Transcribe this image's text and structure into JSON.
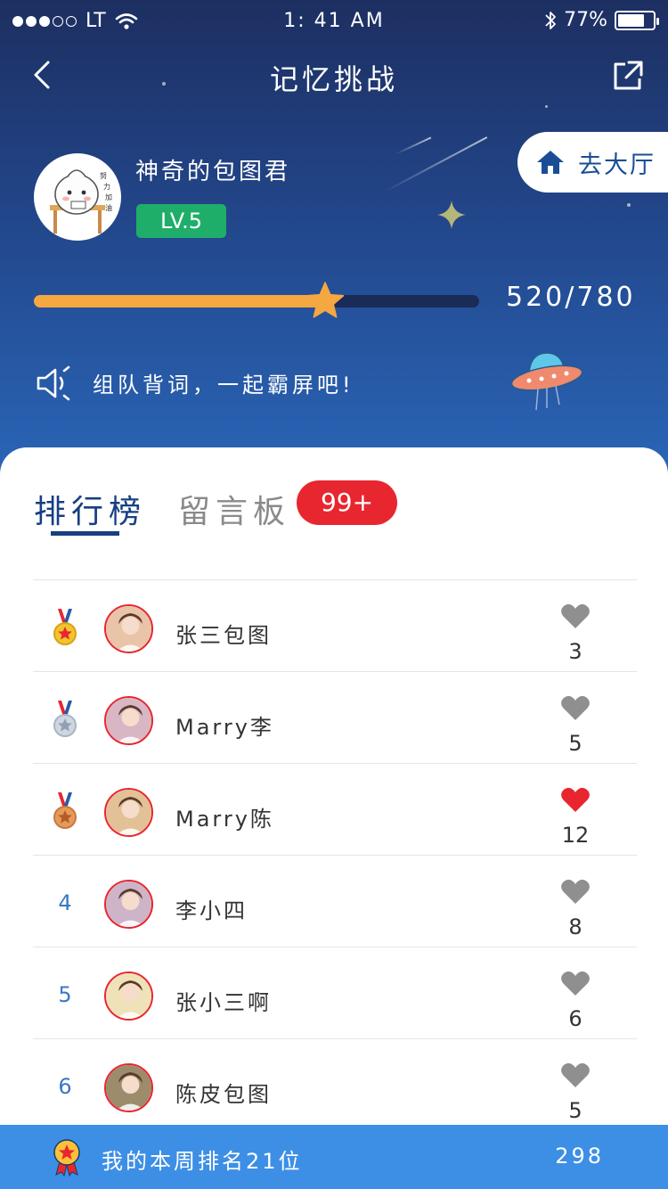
{
  "status_bar": {
    "carrier": "LT",
    "time": "1: 41 AM",
    "battery": "77%",
    "battery_level": 0.77
  },
  "nav": {
    "title": "记忆挑战",
    "back_icon": "chevron-left-icon",
    "share_icon": "share-icon"
  },
  "profile": {
    "name": "神奇的包图君",
    "level": "LV.5",
    "avatar_text": "努力加油"
  },
  "hall_button": {
    "label": "去大厅",
    "icon": "home-icon"
  },
  "progress": {
    "text": "520/780",
    "current": 520,
    "max": 780
  },
  "announcement": {
    "text": "组队背词，一起霸屏吧!"
  },
  "tabs": {
    "rank_label": "排行榜",
    "message_label": "留言板",
    "message_badge": "99+"
  },
  "leaderboard": [
    {
      "rank": "1",
      "medal": "gold",
      "name": "张三包图",
      "likes": "3",
      "liked": false
    },
    {
      "rank": "2",
      "medal": "silver",
      "name": "Marry李",
      "likes": "5",
      "liked": false
    },
    {
      "rank": "3",
      "medal": "bronze",
      "name": "Marry陈",
      "likes": "12",
      "liked": true
    },
    {
      "rank": "4",
      "medal": "",
      "name": "李小四",
      "likes": "8",
      "liked": false
    },
    {
      "rank": "5",
      "medal": "",
      "name": "张小三啊",
      "likes": "6",
      "liked": false
    },
    {
      "rank": "6",
      "medal": "",
      "name": "陈皮包图",
      "likes": "5",
      "liked": false
    }
  ],
  "my_rank": {
    "text": "我的本周排名21位",
    "score": "298"
  },
  "colors": {
    "accent": "#173f82",
    "badge_red": "#e8262f",
    "level_green": "#1fae6a",
    "progress_orange": "#f5a742",
    "bottom_blue": "#3d8fe5"
  }
}
